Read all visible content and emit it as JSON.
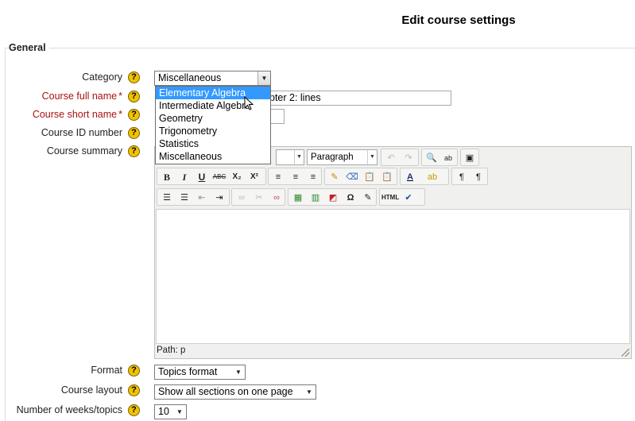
{
  "page_title": "Edit course settings",
  "section_legend": "General",
  "fields": {
    "category_label": "Category",
    "fullname_label": "Course full name",
    "shortname_label": "Course short name",
    "idnumber_label": "Course ID number",
    "summary_label": "Course summary",
    "format_label": "Format",
    "layout_label": "Course layout",
    "weeks_label": "Number of weeks/topics",
    "required_mark": "*",
    "help_glyph": "?"
  },
  "category": {
    "selected": "Miscellaneous",
    "options": [
      "Elementary Algebra",
      "Intermediate Algebra",
      "Geometry",
      "Trigonometry",
      "Statistics",
      "Miscellaneous"
    ],
    "highlighted_index": 0
  },
  "fullname_visible_value": "pter 2: lines",
  "shortname_value": "",
  "editor": {
    "paragraph_format": "Paragraph",
    "path_label": "Path: p",
    "buttons_row2": [
      "B",
      "I",
      "U",
      "ABC",
      "X₂",
      "X²"
    ]
  },
  "format": {
    "selected": "Topics format"
  },
  "layout": {
    "selected": "Show all sections on one page"
  },
  "weeks": {
    "selected": "10"
  },
  "colors": {
    "required": "#aa1111",
    "highlight": "#3399ff",
    "help": "#f2c200"
  }
}
